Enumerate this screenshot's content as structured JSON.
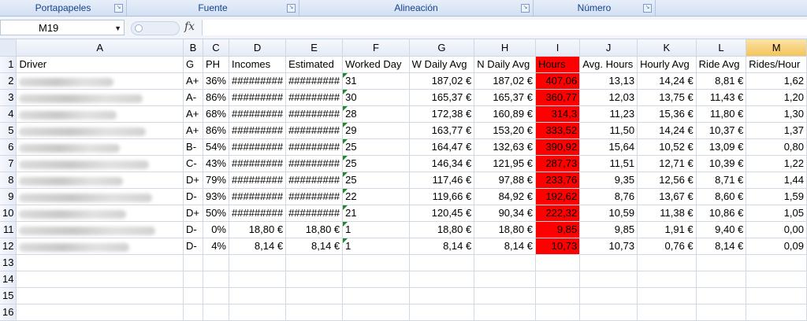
{
  "ribbon": {
    "groups": [
      "Portapapeles",
      "Fuente",
      "Alineación",
      "Número"
    ]
  },
  "formula_bar": {
    "name_box": "M19",
    "fx_label": "fx",
    "formula": ""
  },
  "columns": [
    "A",
    "B",
    "C",
    "D",
    "E",
    "F",
    "G",
    "H",
    "I",
    "J",
    "K",
    "L",
    "M"
  ],
  "selected_column": "M",
  "row_numbers": [
    "1",
    "2",
    "3",
    "4",
    "5",
    "6",
    "7",
    "8",
    "9",
    "10",
    "11",
    "12",
    "13",
    "14",
    "15",
    "16"
  ],
  "headers": [
    "Driver",
    "G",
    "PH",
    "Incomes",
    "Estimated",
    "Worked Day",
    "W Daily Avg",
    "N Daily Avg",
    "Hours",
    "Avg. Hours",
    "Hourly Avg",
    "Ride Avg",
    "Rides/Hour"
  ],
  "rows": [
    [
      "",
      "A+",
      "36%",
      "#########",
      "#########",
      "31",
      "187,02 €",
      "187,02 €",
      "407,06",
      "13,13",
      "14,24 €",
      "8,81 €",
      "1,62"
    ],
    [
      "",
      "A-",
      "86%",
      "#########",
      "#########",
      "30",
      "165,37 €",
      "165,37 €",
      "360,77",
      "12,03",
      "13,75 €",
      "11,43 €",
      "1,20"
    ],
    [
      "",
      "A+",
      "68%",
      "#########",
      "#########",
      "28",
      "172,38 €",
      "160,89 €",
      "314,3",
      "11,23",
      "15,36 €",
      "11,80 €",
      "1,30"
    ],
    [
      "",
      "A+",
      "86%",
      "#########",
      "#########",
      "29",
      "163,77 €",
      "153,20 €",
      "333,52",
      "11,50",
      "14,24 €",
      "10,37 €",
      "1,37"
    ],
    [
      "",
      "B-",
      "54%",
      "#########",
      "#########",
      "25",
      "164,47 €",
      "132,63 €",
      "390,92",
      "15,64",
      "10,52 €",
      "13,09 €",
      "0,80"
    ],
    [
      "",
      "C-",
      "43%",
      "#########",
      "#########",
      "25",
      "146,34 €",
      "121,95 €",
      "287,73",
      "11,51",
      "12,71 €",
      "10,39 €",
      "1,22"
    ],
    [
      "",
      "D+",
      "79%",
      "#########",
      "#########",
      "25",
      "117,46 €",
      "97,88 €",
      "233,76",
      "9,35",
      "12,56 €",
      "8,71 €",
      "1,44"
    ],
    [
      "",
      "D-",
      "93%",
      "#########",
      "#########",
      "22",
      "119,66 €",
      "84,92 €",
      "192,62",
      "8,76",
      "13,67 €",
      "8,60 €",
      "1,59"
    ],
    [
      "",
      "D+",
      "50%",
      "#########",
      "#########",
      "21",
      "120,45 €",
      "90,34 €",
      "222,32",
      "10,59",
      "11,38 €",
      "10,86 €",
      "1,05"
    ],
    [
      "",
      "D-",
      "0%",
      "18,80 €",
      "18,80 €",
      "1",
      "18,80 €",
      "18,80 €",
      "9,85",
      "9,85",
      "1,91 €",
      "9,40 €",
      "0,00"
    ],
    [
      "",
      "D-",
      "4%",
      "8,14 €",
      "8,14 €",
      "1",
      "8,14 €",
      "8,14 €",
      "10,73",
      "10,73",
      "0,76 €",
      "8,14 €",
      "0,09"
    ]
  ],
  "colors": {
    "hours_highlight": "#ff0000",
    "selected_header": "#f4c45a"
  }
}
